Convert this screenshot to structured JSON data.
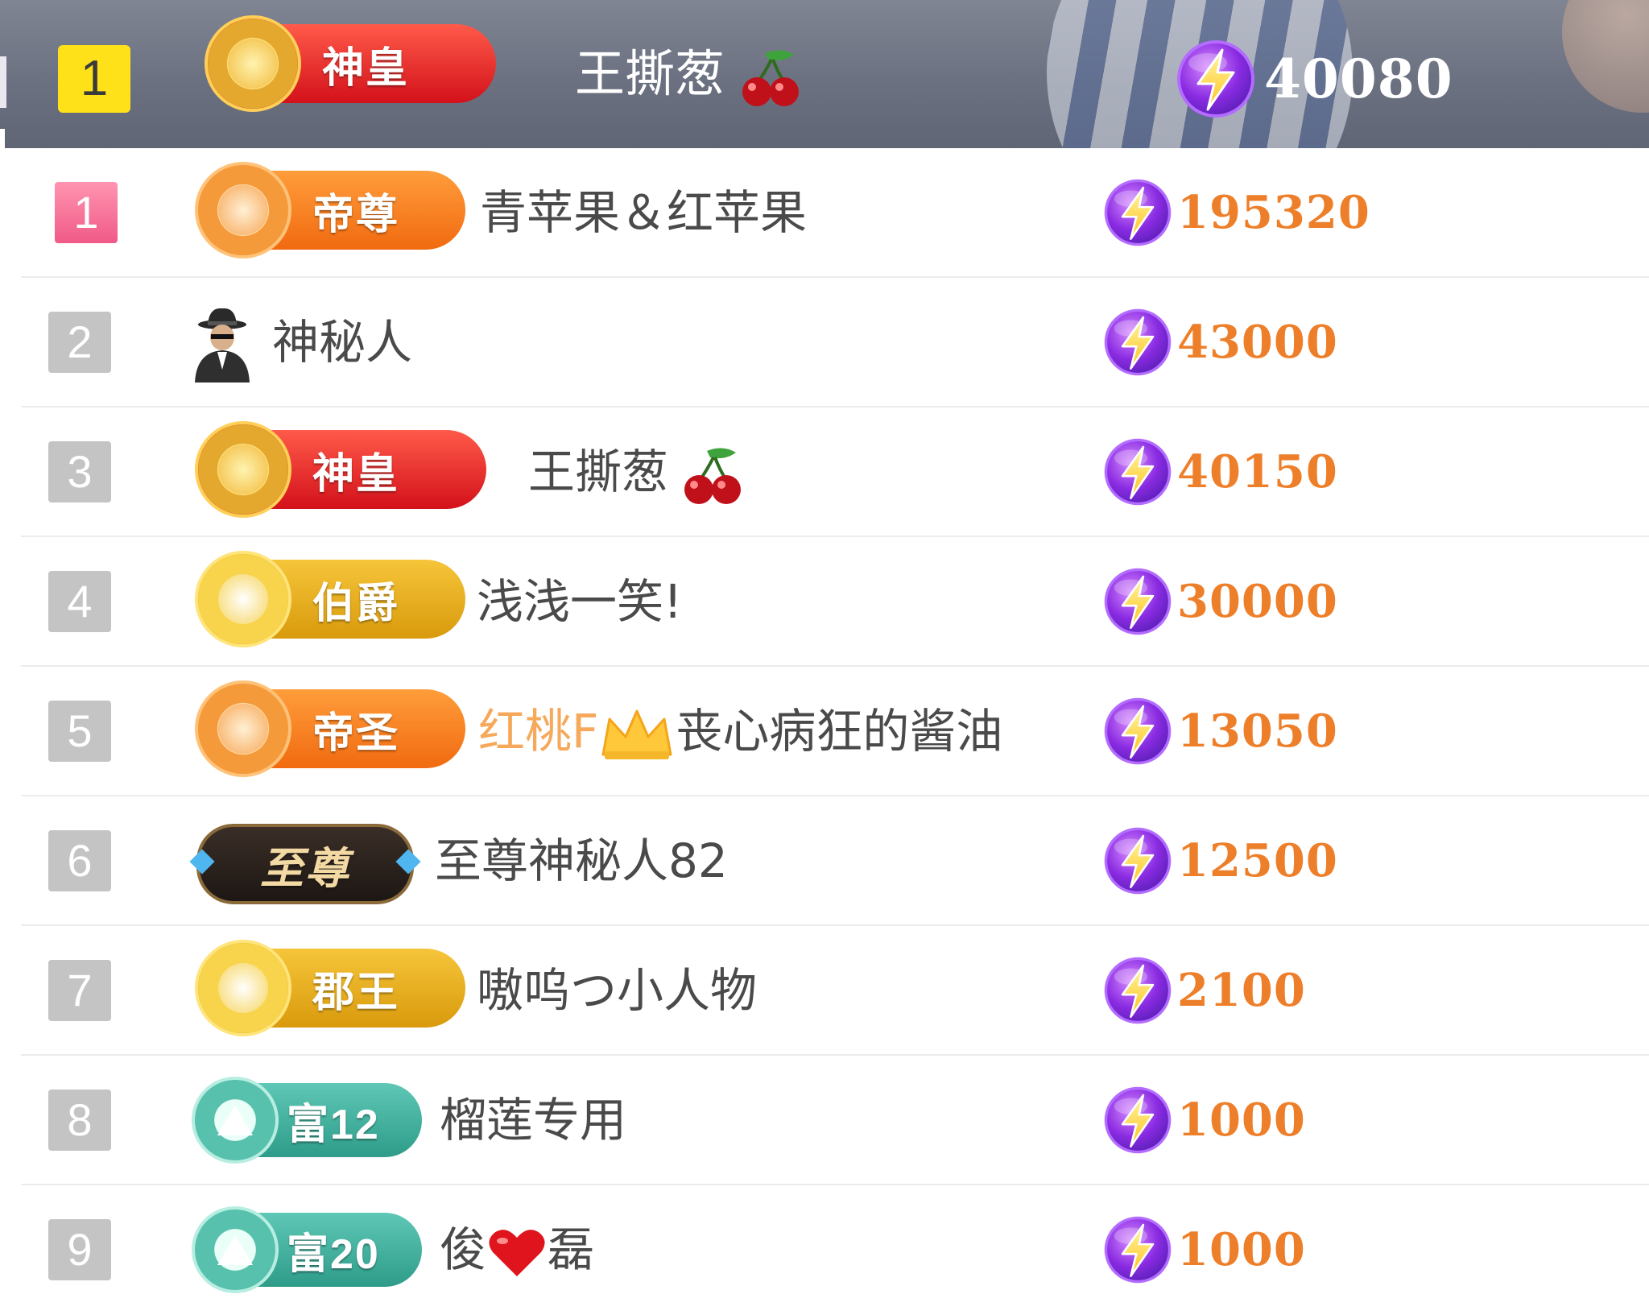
{
  "header": {
    "rank": "1",
    "badge_label": "神皇",
    "name": "王撕葱",
    "points": "40080"
  },
  "rows": [
    {
      "rank": "1",
      "badge_label": "帝尊",
      "name": "青苹果＆红苹果",
      "points": "195320"
    },
    {
      "rank": "2",
      "name": "神秘人",
      "points": "43000"
    },
    {
      "rank": "3",
      "badge_label": "神皇",
      "name": "王撕葱",
      "points": "40150"
    },
    {
      "rank": "4",
      "badge_label": "伯爵",
      "name": "浅浅一笑!",
      "points": "30000"
    },
    {
      "rank": "5",
      "badge_label": "帝圣",
      "name_prefix": "红桃F",
      "name": "丧心病狂的酱油",
      "points": "13050"
    },
    {
      "rank": "6",
      "badge_label": "至尊",
      "name": "至尊神秘人82",
      "points": "12500"
    },
    {
      "rank": "7",
      "badge_label": "郡王",
      "name": "嗷呜つ小人物",
      "points": "2100"
    },
    {
      "rank": "8",
      "badge_label": "富12",
      "name": "榴莲专用",
      "points": "1000"
    },
    {
      "rank": "9",
      "badge_label": "富20",
      "name": "俊",
      "name_suffix": "磊",
      "points": "1000"
    }
  ],
  "icons": {
    "points": "lightning-icon",
    "anonymous": "spy-avatar-icon",
    "cherry": "cherry-icon",
    "crown": "crown-icon",
    "heart": "heart-icon"
  },
  "colors": {
    "points_text": "#ee7f2a",
    "header_bg": "#6b7180",
    "first_rank": "#f05a86",
    "header_rank": "#ffe11a"
  }
}
